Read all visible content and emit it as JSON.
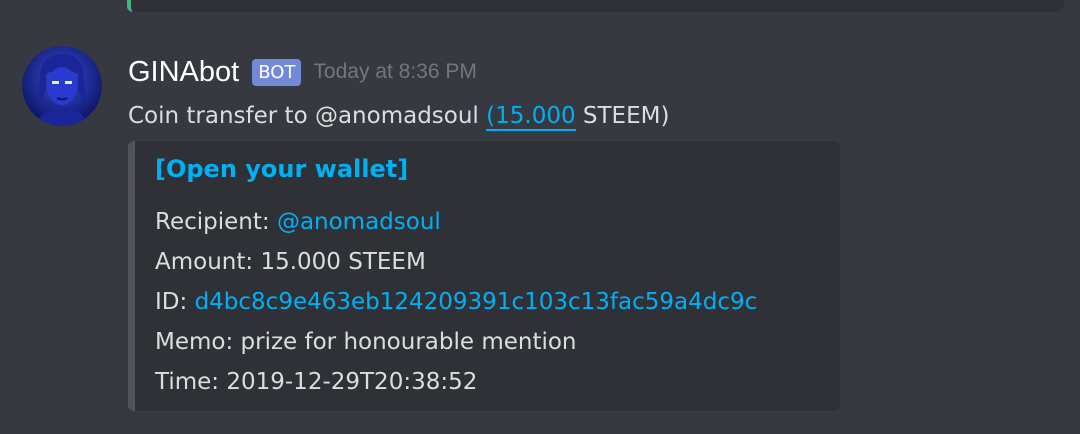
{
  "message": {
    "username": "GINAbot",
    "bot_tag": "BOT",
    "timestamp": "Today at 8:36 PM",
    "content_prefix": "Coin transfer to @anomadsoul ",
    "content_amount": "(15.000",
    "content_suffix": " STEEM)"
  },
  "embed": {
    "title": "[Open your wallet]",
    "recipient_label": "Recipient: ",
    "recipient_value": "@anomadsoul",
    "amount_text": "Amount: 15.000 STEEM",
    "id_label": "ID: ",
    "id_value": "d4bc8c9e463eb124209391c103c13fac59a4dc9c",
    "memo_text": "Memo: prize for honourable mention",
    "time_text": "Time: 2019-12-29T20:38:52"
  },
  "colors": {
    "background": "#36393f",
    "embed_background": "#2f3136",
    "link": "#00b0f4",
    "bot_tag": "#7289da",
    "text": "#dcddde",
    "muted": "#72767d"
  }
}
